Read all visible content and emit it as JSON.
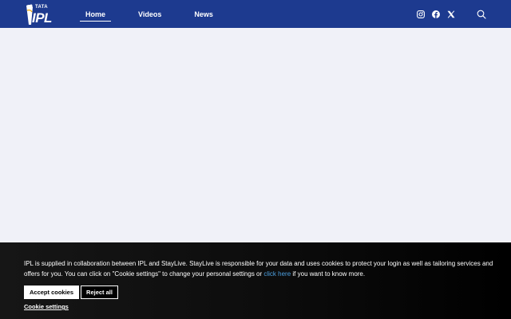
{
  "header": {
    "logo": {
      "brand_top": "TATA",
      "brand_main": "IPL"
    },
    "nav": [
      {
        "label": "Home",
        "active": true
      },
      {
        "label": "Videos",
        "active": false
      },
      {
        "label": "News",
        "active": false
      }
    ],
    "social_icons": [
      "instagram-icon",
      "facebook-icon",
      "x-twitter-icon"
    ],
    "search_icon": "search-icon",
    "colors": {
      "background": "#1d3a8f",
      "text": "#ffffff"
    }
  },
  "main": {
    "background": "#f0f1f8"
  },
  "cookie_banner": {
    "text_before_link": "IPL is supplied in collaboration between IPL and StayLive. StayLive is responsible for your data and uses cookies to protect your login as well as tailoring services and offers for you. You can click on \"Cookie settings\" to change your personal settings or ",
    "link_text": "click here",
    "text_after_link": " if you want to know more.",
    "accept_label": "Accept cookies",
    "reject_label": "Reject all",
    "settings_label": "Cookie settings",
    "colors": {
      "link": "#4da0e0",
      "background": "#000000"
    }
  }
}
